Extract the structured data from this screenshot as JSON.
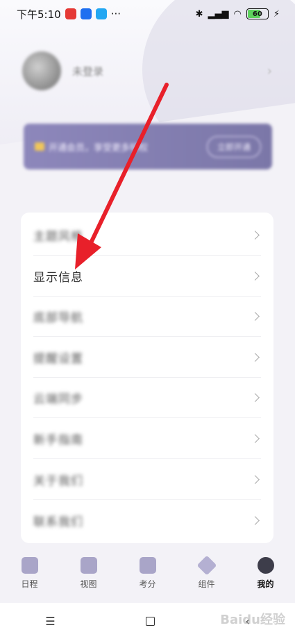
{
  "status_bar": {
    "time": "下午5:10",
    "app_badges": [
      {
        "name": "netease-music-icon",
        "label": ""
      },
      {
        "name": "zhihu-icon",
        "label": "知乎"
      },
      {
        "name": "message-icon",
        "label": ""
      }
    ],
    "more": "···",
    "battery": "60",
    "charging": "⚡"
  },
  "profile": {
    "username": "未登录"
  },
  "vip_banner": {
    "text": "开通会员，享受更多特权",
    "button": "立即开通"
  },
  "menu": {
    "items": [
      {
        "label": "主题风格",
        "blurred": true
      },
      {
        "label": "显示信息",
        "blurred": false
      },
      {
        "label": "底部导航",
        "blurred": true
      },
      {
        "label": "提醒设置",
        "blurred": true
      },
      {
        "label": "云端同步",
        "blurred": true
      },
      {
        "label": "新手指南",
        "blurred": true
      },
      {
        "label": "关于我们",
        "blurred": true
      },
      {
        "label": "联系我们",
        "blurred": true
      }
    ]
  },
  "tabbar": {
    "tabs": [
      {
        "label": "日程",
        "icon": "calendar-icon"
      },
      {
        "label": "视图",
        "icon": "layout-icon"
      },
      {
        "label": "考分",
        "icon": "chart-icon"
      },
      {
        "label": "组件",
        "icon": "cube-icon"
      },
      {
        "label": "我的",
        "icon": "profile-icon",
        "active": true
      }
    ]
  },
  "nav": {
    "menu": "☰",
    "back": "‹"
  },
  "watermark": "Baidu经验",
  "colors": {
    "accent": "#e8202a",
    "tab_icon": "#a9a5c8",
    "banner": "#8d87bb"
  }
}
